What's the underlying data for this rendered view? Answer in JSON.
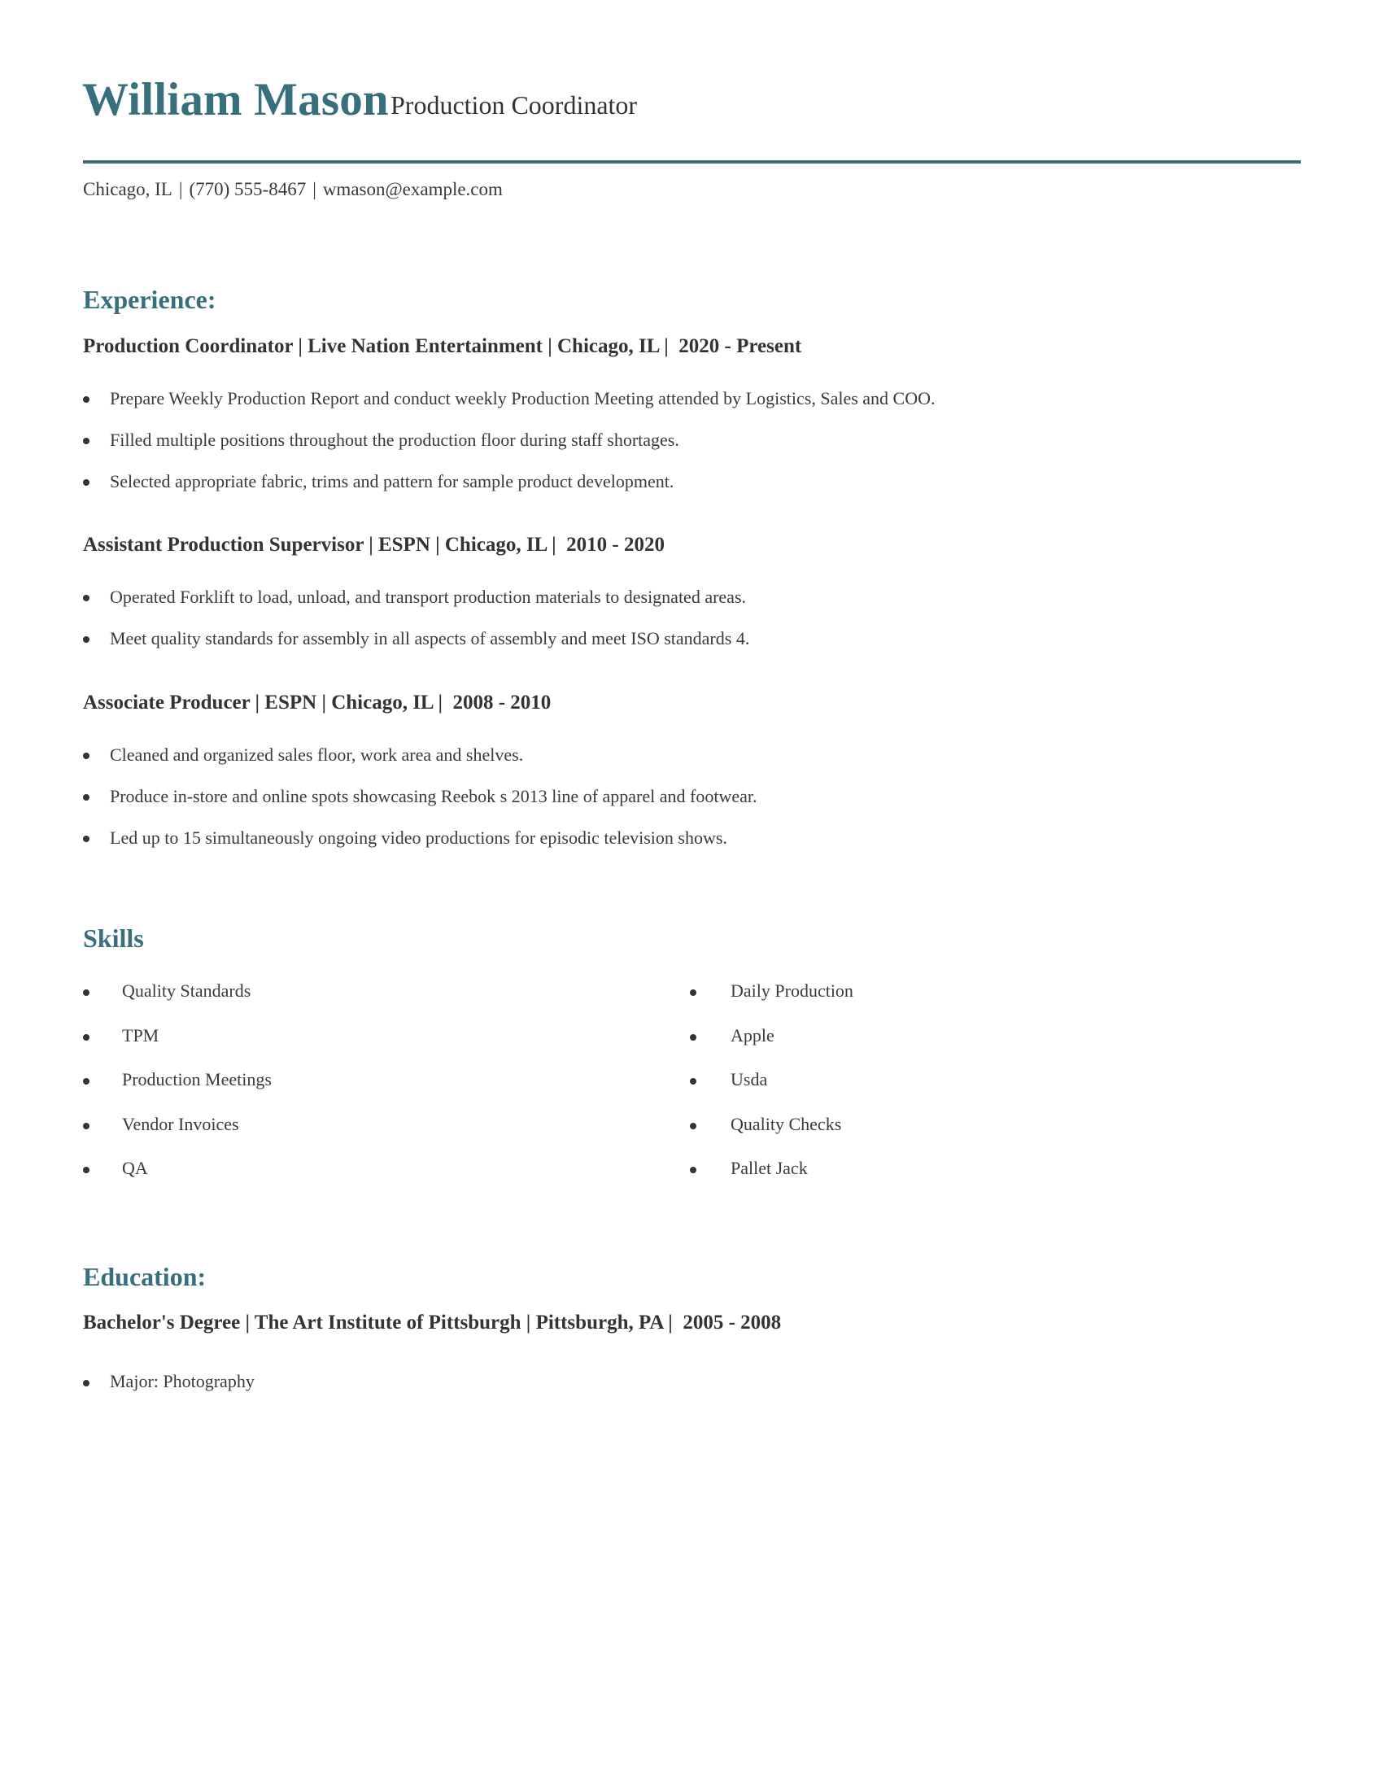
{
  "header": {
    "name": "William Mason",
    "headline": "Production Coordinator",
    "contact": {
      "location": "Chicago, IL",
      "phone": "(770) 555-8467",
      "email": "wmason@example.com",
      "separator": "|"
    }
  },
  "colors": {
    "accent": "#376f7c",
    "text": "#333333"
  },
  "experience": {
    "heading": "Experience:",
    "jobs": [
      {
        "title_line": "Production Coordinator | Live Nation Entertainment | Chicago, IL |  2020 - Present",
        "bullets": [
          "Prepare Weekly Production Report and conduct weekly Production Meeting attended by Logistics, Sales and COO.",
          "Filled multiple positions throughout the production floor during staff shortages.",
          "Selected appropriate fabric, trims and pattern for sample product development."
        ]
      },
      {
        "title_line": "Assistant Production Supervisor | ESPN | Chicago, IL |  2010 - 2020",
        "bullets": [
          "Operated Forklift to load, unload, and transport production materials to designated areas.",
          "Meet quality standards for assembly in all aspects of assembly and meet ISO standards 4."
        ]
      },
      {
        "title_line": "Associate Producer | ESPN | Chicago, IL |  2008 - 2010",
        "bullets": [
          "Cleaned and organized sales floor, work area and shelves.",
          "Produce in-store and online spots showcasing Reebok s 2013 line of apparel and footwear.",
          "Led up to 15 simultaneously ongoing video productions for episodic television shows."
        ]
      }
    ]
  },
  "skills": {
    "heading": "Skills",
    "left": [
      "Quality Standards",
      "TPM",
      "Production Meetings",
      "Vendor Invoices",
      "QA"
    ],
    "right": [
      "Daily Production",
      "Apple",
      "Usda",
      "Quality Checks",
      "Pallet Jack"
    ]
  },
  "education": {
    "heading": "Education:",
    "title_line": "Bachelor's Degree | The Art Institute of Pittsburgh | Pittsburgh, PA |  2005 - 2008",
    "bullets": [
      "Major: Photography"
    ]
  }
}
